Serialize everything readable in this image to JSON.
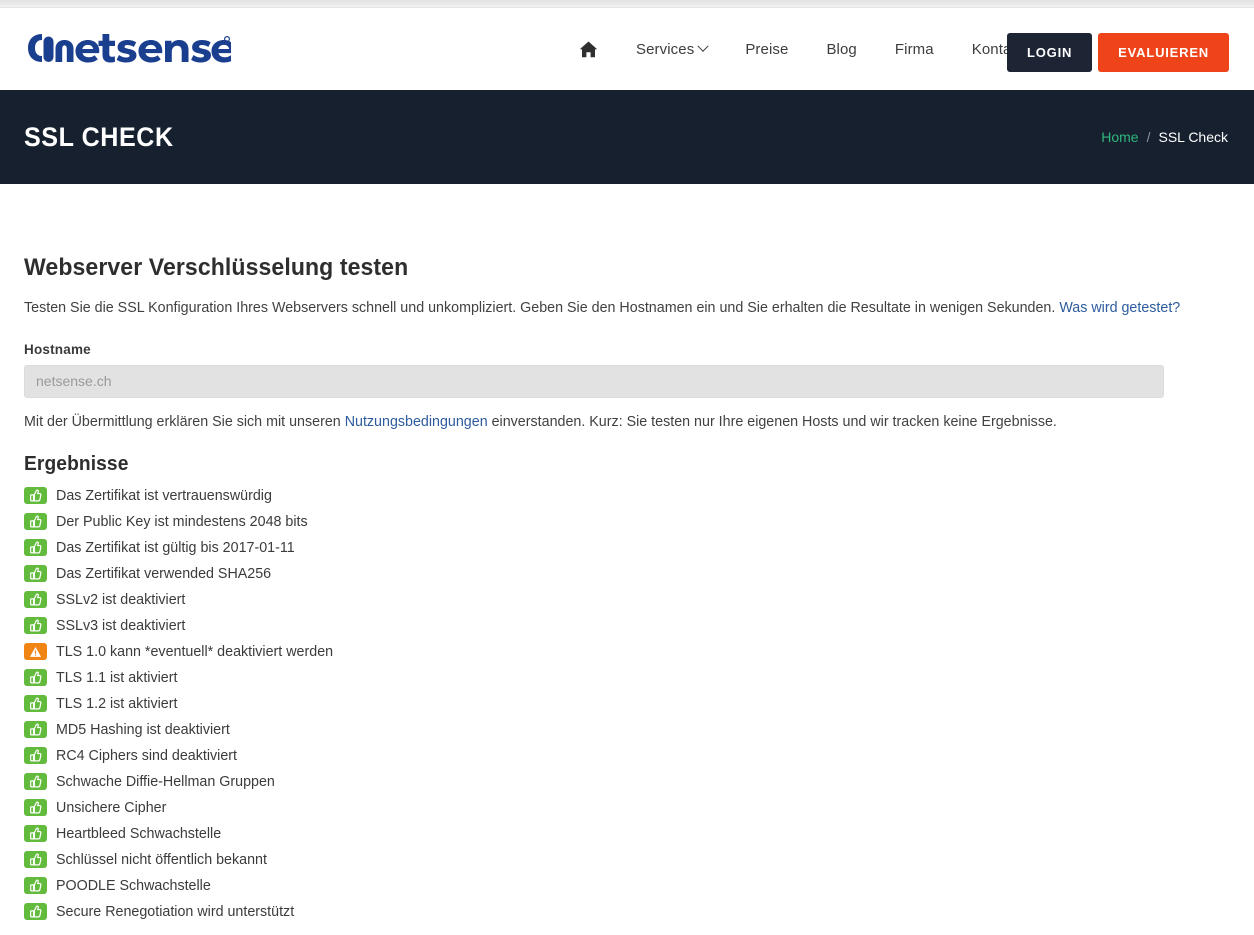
{
  "brand": {
    "logo_text": "netsense",
    "logo_trademark": "®",
    "logo_color": "#1b3f8f"
  },
  "nav": {
    "home_icon": "home-icon",
    "items": [
      {
        "label": "Services",
        "has_dropdown": true
      },
      {
        "label": "Preise",
        "has_dropdown": false
      },
      {
        "label": "Blog",
        "has_dropdown": false
      },
      {
        "label": "Firma",
        "has_dropdown": false
      },
      {
        "label": "Kontakt",
        "has_dropdown": false
      }
    ],
    "login_label": "LOGIN",
    "evaluate_label": "EVALUIEREN",
    "login_color": "#1d2433",
    "evaluate_color": "#ef4419"
  },
  "banner": {
    "title": "SSL CHECK",
    "background": "#16202e",
    "breadcrumb": {
      "home": "Home",
      "separator": "/",
      "current": "SSL Check",
      "home_color": "#2fb67c"
    }
  },
  "main": {
    "heading": "Webserver Verschlüsselung testen",
    "lead_text": "Testen Sie die SSL Konfiguration Ihres Webservers schnell und unkompliziert. Geben Sie den Hostnamen ein und Sie erhalten die Resultate in wenigen Sekunden. ",
    "lead_link": "Was wird getestet?",
    "form": {
      "hostname_label": "Hostname",
      "hostname_value": "",
      "hostname_placeholder": "netsense.ch"
    },
    "terms_prefix": "Mit der Übermittlung erklären Sie sich mit unseren ",
    "terms_link": "Nutzungsbedingungen",
    "terms_suffix": " einverstanden. Kurz: Sie testen nur Ihre eigenen Hosts und wir tracken keine Ergebnisse.",
    "results_title": "Ergebnisse",
    "results": [
      {
        "status": "ok",
        "icon": "thumbs-up-icon",
        "text": "Das Zertifikat ist vertrauenswürdig"
      },
      {
        "status": "ok",
        "icon": "thumbs-up-icon",
        "text": "Der Public Key ist mindestens 2048 bits"
      },
      {
        "status": "ok",
        "icon": "thumbs-up-icon",
        "text": "Das Zertifikat ist gültig bis 2017-01-11"
      },
      {
        "status": "ok",
        "icon": "thumbs-up-icon",
        "text": "Das Zertifikat verwended SHA256"
      },
      {
        "status": "ok",
        "icon": "thumbs-up-icon",
        "text": "SSLv2 ist deaktiviert"
      },
      {
        "status": "ok",
        "icon": "thumbs-up-icon",
        "text": "SSLv3 ist deaktiviert"
      },
      {
        "status": "warn",
        "icon": "warning-triangle-icon",
        "text": "TLS 1.0 kann *eventuell* deaktiviert werden"
      },
      {
        "status": "ok",
        "icon": "thumbs-up-icon",
        "text": "TLS 1.1 ist aktiviert"
      },
      {
        "status": "ok",
        "icon": "thumbs-up-icon",
        "text": "TLS 1.2 ist aktiviert"
      },
      {
        "status": "ok",
        "icon": "thumbs-up-icon",
        "text": "MD5 Hashing ist deaktiviert"
      },
      {
        "status": "ok",
        "icon": "thumbs-up-icon",
        "text": "RC4 Ciphers sind deaktiviert"
      },
      {
        "status": "ok",
        "icon": "thumbs-up-icon",
        "text": "Schwache Diffie-Hellman Gruppen"
      },
      {
        "status": "ok",
        "icon": "thumbs-up-icon",
        "text": "Unsichere Cipher"
      },
      {
        "status": "ok",
        "icon": "thumbs-up-icon",
        "text": "Heartbleed Schwachstelle"
      },
      {
        "status": "ok",
        "icon": "thumbs-up-icon",
        "text": "Schlüssel nicht öffentlich bekannt"
      },
      {
        "status": "ok",
        "icon": "thumbs-up-icon",
        "text": "POODLE Schwachstelle"
      },
      {
        "status": "ok",
        "icon": "thumbs-up-icon",
        "text": "Secure Renegotiation wird unterstützt"
      }
    ],
    "status_colors": {
      "ok": "#63bb3d",
      "warn": "#f08513"
    }
  }
}
